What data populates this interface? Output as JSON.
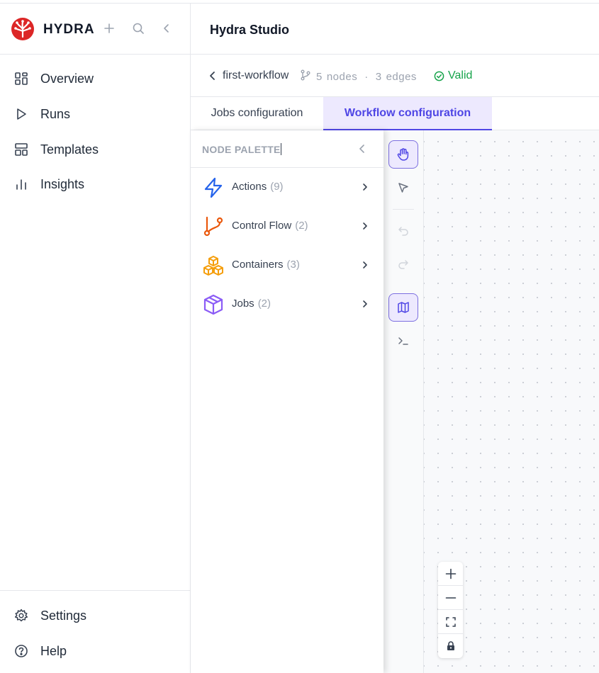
{
  "app": {
    "name": "HYDRA",
    "brand_color": "#dc2626"
  },
  "sidebar": {
    "top_actions": [
      {
        "icon": "plus-icon"
      },
      {
        "icon": "search-icon"
      },
      {
        "icon": "collapse-sidebar-icon"
      }
    ],
    "items": [
      {
        "label": "Overview",
        "icon": "grid-icon"
      },
      {
        "label": "Runs",
        "icon": "play-icon"
      },
      {
        "label": "Templates",
        "icon": "layout-icon"
      },
      {
        "label": "Insights",
        "icon": "bar-chart-icon"
      }
    ],
    "bottom_items": [
      {
        "label": "Settings",
        "icon": "gear-icon"
      },
      {
        "label": "Help",
        "icon": "help-circle-icon"
      }
    ]
  },
  "header": {
    "title": "Hydra Studio"
  },
  "workflow": {
    "name": "first-workflow",
    "nodes_count": "5",
    "nodes_label": "nodes",
    "separator": "·",
    "edges_count": "3",
    "edges_label": "edges",
    "status": "Valid",
    "status_color": "#16a34a"
  },
  "tabs": [
    {
      "label": "Jobs configuration",
      "active": false
    },
    {
      "label": "Workflow configuration",
      "active": true
    }
  ],
  "palette": {
    "title": "NODE PALETTE",
    "items": [
      {
        "label": "Actions",
        "count": "(9)",
        "icon": "lightning-icon",
        "color": "#2563eb"
      },
      {
        "label": "Control Flow",
        "count": "(2)",
        "icon": "git-branch-icon",
        "color": "#ea580c"
      },
      {
        "label": "Containers",
        "count": "(3)",
        "icon": "boxes-icon",
        "color": "#f59e0b"
      },
      {
        "label": "Jobs",
        "count": "(2)",
        "icon": "package-icon",
        "color": "#8b5cf6"
      }
    ]
  },
  "tools": [
    {
      "icon": "hand-icon",
      "state": "active"
    },
    {
      "icon": "pointer-icon",
      "state": "normal"
    },
    {
      "icon": "undo-icon",
      "state": "disabled"
    },
    {
      "icon": "redo-icon",
      "state": "disabled"
    },
    {
      "icon": "map-icon",
      "state": "active"
    },
    {
      "icon": "terminal-icon",
      "state": "normal"
    }
  ],
  "zoom_controls": [
    {
      "icon": "zoom-in-icon"
    },
    {
      "icon": "zoom-out-icon"
    },
    {
      "icon": "fit-view-icon"
    },
    {
      "icon": "lock-icon"
    }
  ],
  "accent_color": "#4f46e5"
}
